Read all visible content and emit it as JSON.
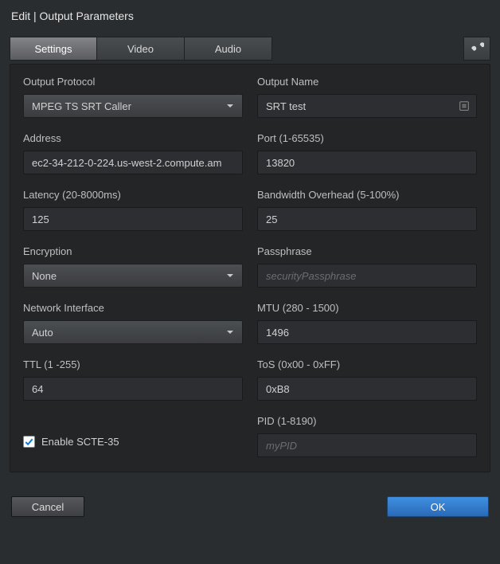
{
  "title": "Edit | Output Parameters",
  "tabs": {
    "settings": "Settings",
    "video": "Video",
    "audio": "Audio"
  },
  "fields": {
    "output_protocol": {
      "label": "Output Protocol",
      "value": "MPEG TS SRT Caller"
    },
    "output_name": {
      "label": "Output Name",
      "value": "SRT test"
    },
    "address": {
      "label": "Address",
      "value": "ec2-34-212-0-224.us-west-2.compute.am"
    },
    "port": {
      "label": "Port (1-65535)",
      "value": "13820"
    },
    "latency": {
      "label": "Latency (20-8000ms)",
      "value": "125"
    },
    "bandwidth": {
      "label": "Bandwidth Overhead (5-100%)",
      "value": "25"
    },
    "encryption": {
      "label": "Encryption",
      "value": "None"
    },
    "passphrase": {
      "label": "Passphrase",
      "value": "",
      "placeholder": "securityPassphrase"
    },
    "net_if": {
      "label": "Network Interface",
      "value": "Auto"
    },
    "mtu": {
      "label": "MTU (280 - 1500)",
      "value": "1496"
    },
    "ttl": {
      "label": "TTL (1 -255)",
      "value": "64"
    },
    "tos": {
      "label": "ToS (0x00 - 0xFF)",
      "value": "0xB8"
    },
    "pid": {
      "label": "PID (1-8190)",
      "value": "",
      "placeholder": "myPID"
    }
  },
  "scte35": {
    "label": "Enable SCTE-35",
    "checked": true
  },
  "buttons": {
    "cancel": "Cancel",
    "ok": "OK"
  }
}
